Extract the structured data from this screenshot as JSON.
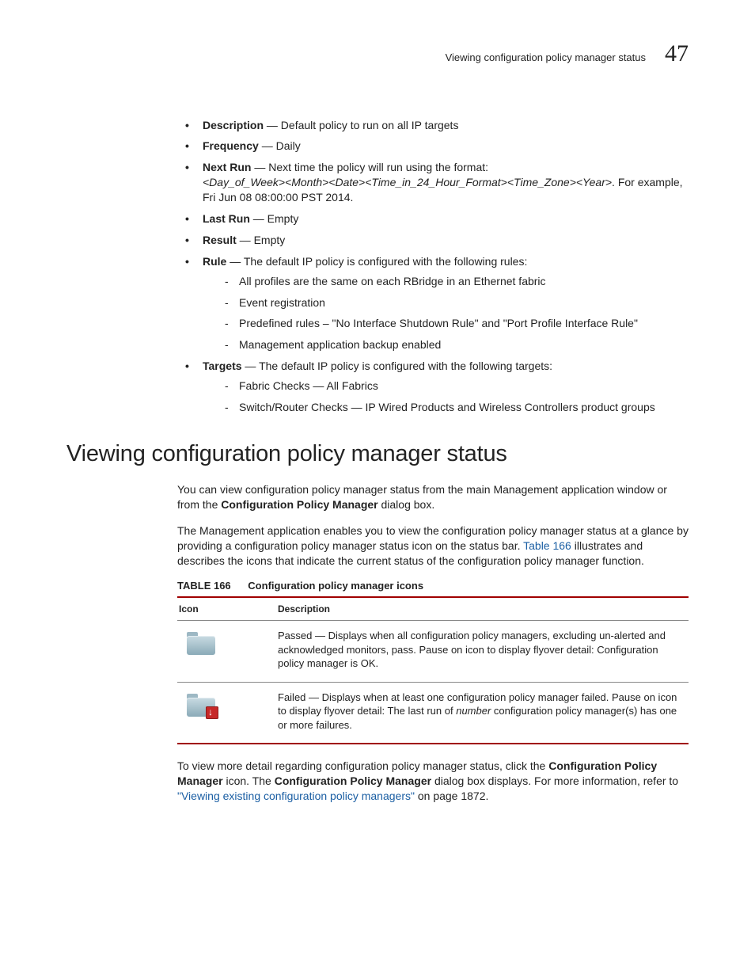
{
  "header": {
    "running_title": "Viewing configuration policy manager status",
    "chapter_number": "47"
  },
  "bullets": {
    "description": {
      "term": "Description",
      "text": " — Default policy to run on all IP targets"
    },
    "frequency": {
      "term": "Frequency",
      "text": " — Daily"
    },
    "nextrun": {
      "term": "Next Run",
      "lead": " — Next time the policy will run using the format: ",
      "format": "<Day_of_Week><Month><Date><Time_in_24_Hour_Format><Time_Zone><Year>",
      "tail": ". For example, Fri Jun 08 08:00:00 PST 2014."
    },
    "lastrun": {
      "term": "Last Run",
      "text": " — Empty"
    },
    "result": {
      "term": "Result",
      "text": " — Empty"
    },
    "rule": {
      "term": "Rule",
      "lead": " — The default IP policy is configured with the following rules:",
      "items": [
        "All profiles are the same on each RBridge in an Ethernet fabric",
        "Event registration",
        "Predefined rules – \"No Interface Shutdown Rule\" and \"Port Profile Interface Rule\"",
        "Management application backup enabled"
      ]
    },
    "targets": {
      "term": "Targets",
      "lead": " — The default IP policy is configured with the following targets:",
      "items": [
        "Fabric Checks — All Fabrics",
        "Switch/Router Checks — IP Wired Products and Wireless Controllers product groups"
      ]
    }
  },
  "section": {
    "title": "Viewing configuration policy manager status",
    "p1a": "You can view configuration policy manager status from the main Management application window or from the ",
    "p1b": "Configuration Policy Manager",
    "p1c": " dialog box.",
    "p2a": "The Management application enables you to view the configuration policy manager status at a glance by providing a configuration policy manager status icon on the status bar. ",
    "p2link": "Table 166",
    "p2b": " illustrates and describes the icons that indicate the current status of the configuration policy manager function."
  },
  "table": {
    "label": "TABLE 166",
    "caption": "Configuration policy manager icons",
    "headers": {
      "icon": "Icon",
      "desc": "Description"
    },
    "rows": [
      {
        "desc": "Passed — Displays when all configuration policy managers, excluding un-alerted and acknowledged monitors, pass. Pause on icon to display flyover detail: Configuration policy manager is OK."
      },
      {
        "desc_a": "Failed — Displays when at least one configuration policy manager failed. Pause on icon to display flyover detail: The last run of ",
        "desc_i": "number",
        "desc_b": " configuration policy manager(s) has one or more failures."
      }
    ]
  },
  "after": {
    "a": "To view more detail regarding configuration policy manager status, click the ",
    "b": "Configuration Policy Manager",
    "c": " icon. The ",
    "d": "Configuration Policy Manager",
    "e": " dialog box displays. For more information, refer to ",
    "link": "\"Viewing existing configuration policy managers\"",
    "f": " on page 1872."
  }
}
